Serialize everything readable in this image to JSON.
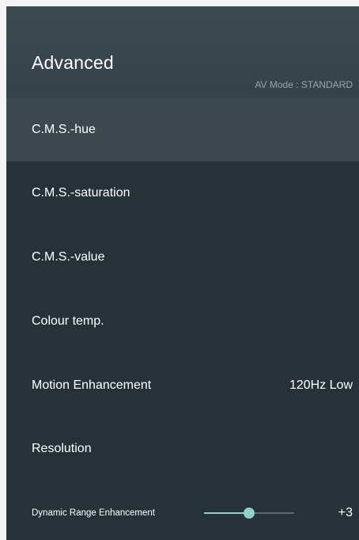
{
  "header": {
    "title": "Advanced",
    "av_mode": "AV Mode : STANDARD"
  },
  "menu": {
    "items": [
      {
        "label": "C.M.S.-hue",
        "value": "",
        "selected": true
      },
      {
        "label": "C.M.S.-saturation",
        "value": ""
      },
      {
        "label": "C.M.S.-value",
        "value": ""
      },
      {
        "label": "Colour temp.",
        "value": ""
      },
      {
        "label": "Motion Enhancement",
        "value": "120Hz Low"
      },
      {
        "label": "Resolution",
        "value": ""
      }
    ],
    "dynamic_range": {
      "label": "Dynamic Range Enhancement",
      "value_text": "+3",
      "level_fraction": 0.5
    }
  },
  "colors": {
    "background": "#263238",
    "header": "#3d4a50",
    "selected_row": "#3c484e",
    "accent": "#8fd0cf"
  }
}
